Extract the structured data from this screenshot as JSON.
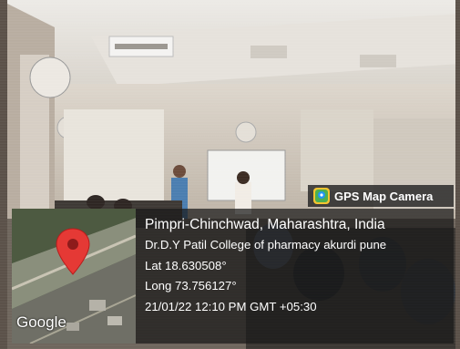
{
  "badge": {
    "label": "GPS Map Camera",
    "icon": "gps-map-camera-icon"
  },
  "location": {
    "place": "Pimpri-Chinchwad, Maharashtra, India",
    "address": "Dr.D.Y Patil College of pharmacy akurdi pune",
    "lat": "Lat 18.630508°",
    "long": "Long 73.756127°",
    "datetime": "21/01/22 12:10 PM GMT +05:30"
  },
  "map": {
    "brand": "Google",
    "pin_color": "#e53935"
  }
}
